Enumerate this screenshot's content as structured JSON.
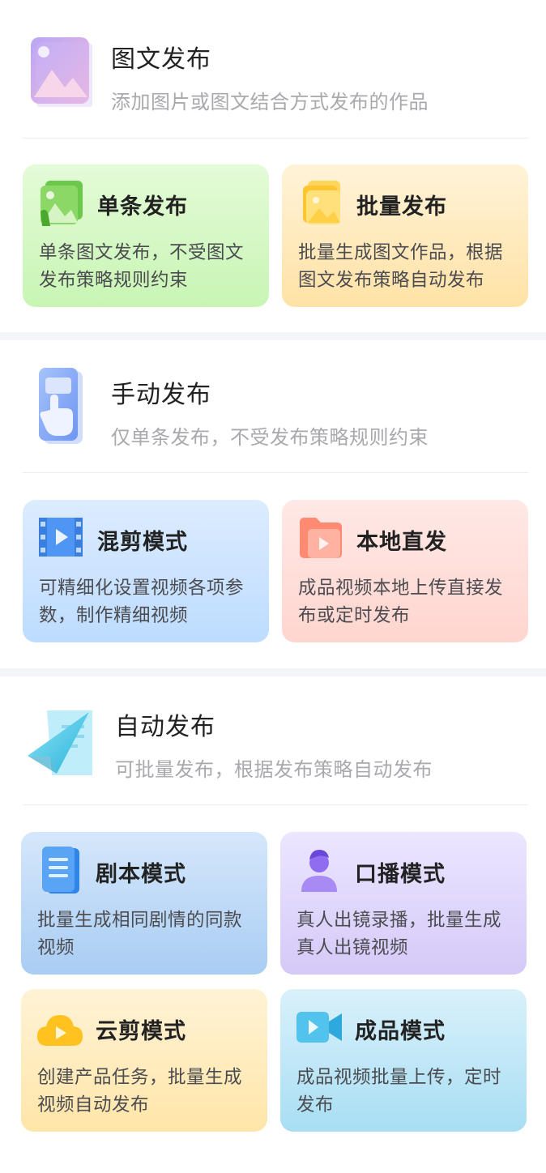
{
  "sections": [
    {
      "title": "图文发布",
      "desc": "添加图片或图文结合方式发布的作品",
      "icon": "image-post-icon",
      "cards": [
        {
          "title": "单条发布",
          "desc": "单条图文发布，不受图文发布策略规则约束",
          "icon": "single-image-icon",
          "color": "#c8f5b4"
        },
        {
          "title": "批量发布",
          "desc": "批量生成图文作品，根据图文发布策略自动发布",
          "icon": "image-stack-icon",
          "color": "#ffe2a6"
        }
      ]
    },
    {
      "title": "手动发布",
      "desc": "仅单条发布，不受发布策略规则约束",
      "icon": "manual-touch-icon",
      "cards": [
        {
          "title": "混剪模式",
          "desc": "可精细化设置视频各项参数，制作精细视频",
          "icon": "film-strip-icon",
          "color": "#bddcff"
        },
        {
          "title": "本地直发",
          "desc": "成品视频本地上传直接发布或定时发布",
          "icon": "video-folder-icon",
          "color": "#ffd5cf"
        }
      ]
    },
    {
      "title": "自动发布",
      "desc": "可批量发布，根据发布策略自动发布",
      "icon": "paper-plane-icon",
      "cards": [
        {
          "title": "剧本模式",
          "desc": "批量生成相同剧情的同款视频",
          "icon": "script-doc-icon",
          "color": "#a9cdf3"
        },
        {
          "title": "口播模式",
          "desc": "真人出镜录播，批量生成真人出镜视频",
          "icon": "presenter-icon",
          "color": "#d5c9f8"
        },
        {
          "title": "云剪模式",
          "desc": "创建产品任务，批量生成视频自动发布",
          "icon": "cloud-play-icon",
          "color": "#ffe5a8"
        },
        {
          "title": "成品模式",
          "desc": "成品视频批量上传，定时发布",
          "icon": "video-camera-icon",
          "color": "#a8def3"
        }
      ]
    }
  ]
}
